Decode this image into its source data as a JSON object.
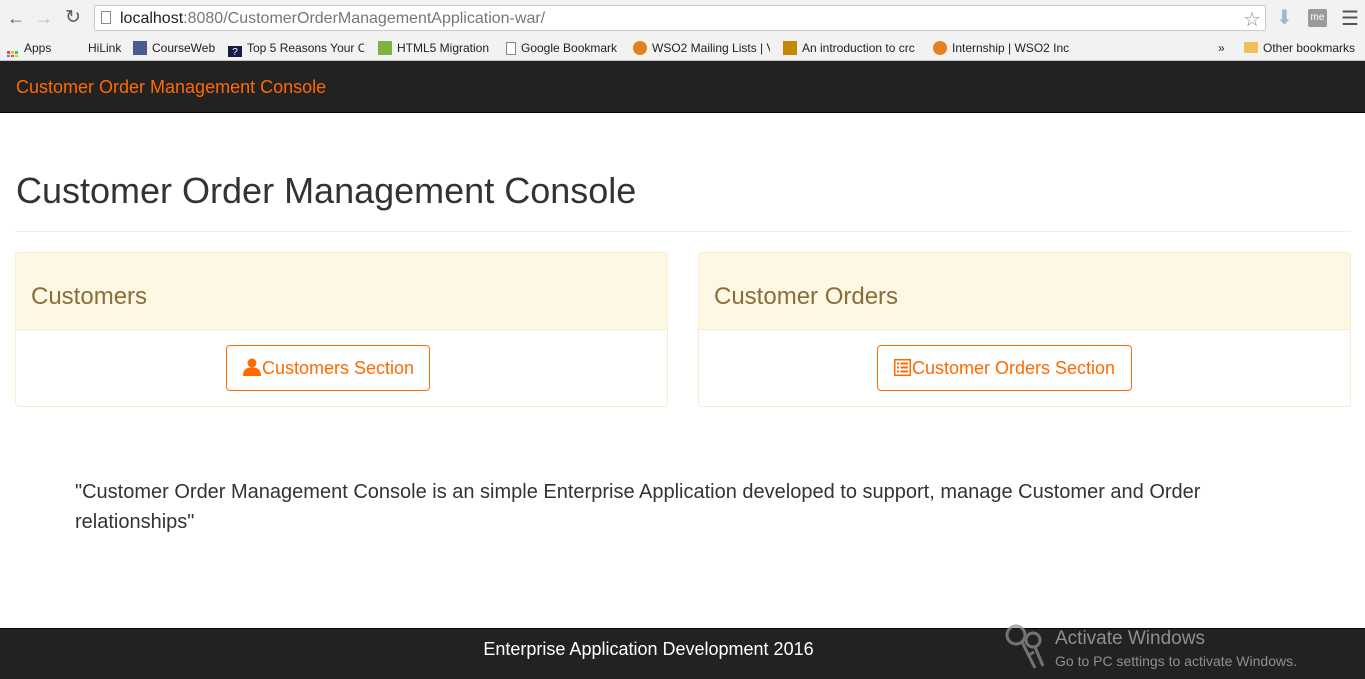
{
  "browser": {
    "url_host": "localhost",
    "url_rest": ":8080/CustomerOrderManagementApplication-war/",
    "bookmarks": [
      {
        "label": "Apps"
      },
      {
        "label": "HiLink"
      },
      {
        "label": "CourseWeb"
      },
      {
        "label": "Top 5 Reasons Your C"
      },
      {
        "label": "HTML5 Migration"
      },
      {
        "label": "Google Bookmark"
      },
      {
        "label": "WSO2 Mailing Lists | V"
      },
      {
        "label": "An introduction to crc"
      },
      {
        "label": "Internship | WSO2 Inc"
      }
    ],
    "overflow": "»",
    "other_bookmarks": "Other bookmarks",
    "ext_label": "me"
  },
  "navbar": {
    "brand": "Customer Order Management Console"
  },
  "main": {
    "title": "Customer Order Management Console",
    "panels": [
      {
        "title": "Customers",
        "button": "Customers Section"
      },
      {
        "title": "Customer Orders",
        "button": "Customer Orders Section"
      }
    ],
    "quote": "\"Customer Order Management Console is an simple Enterprise Application developed to support, manage Customer and Order relationships\""
  },
  "footer": {
    "text": "Enterprise Application Development 2016"
  },
  "watermark": {
    "title": "Activate Windows",
    "subtitle": "Go to PC settings to activate Windows."
  },
  "colors": {
    "accent": "#ff6a00",
    "panel_heading_bg": "#fcf8e3",
    "panel_title": "#8a6d3b",
    "navbar_bg": "#222222"
  }
}
